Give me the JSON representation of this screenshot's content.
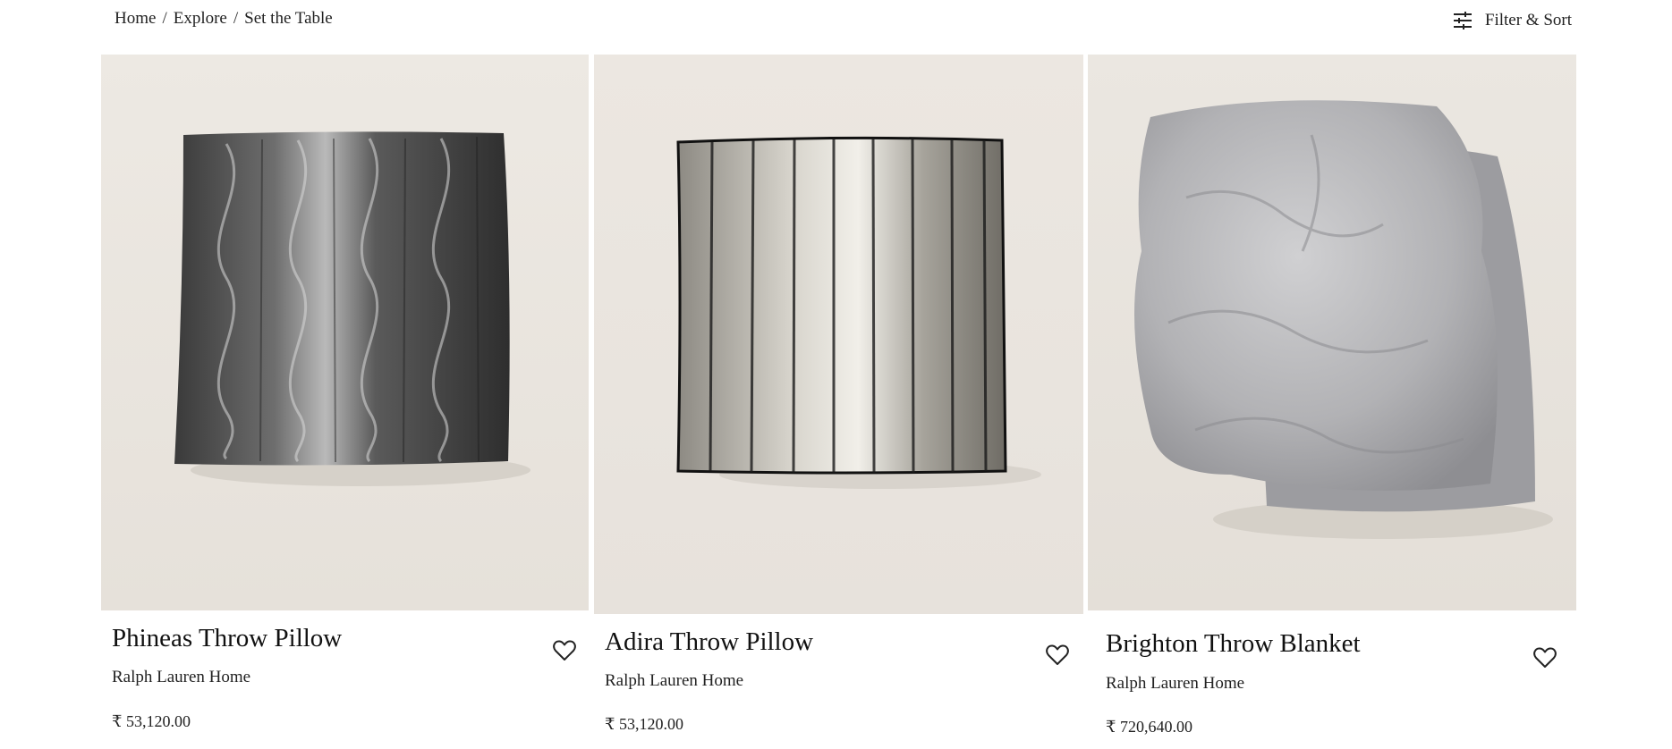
{
  "breadcrumb": {
    "items": [
      "Home",
      "Explore",
      "Set the Table"
    ],
    "separator": "/"
  },
  "toolbar": {
    "filter_sort_label": "Filter & Sort",
    "filter_icon": "sliders-icon"
  },
  "products": [
    {
      "name": "Phineas Throw Pillow",
      "brand": "Ralph Lauren Home",
      "price": "₹ 53,120.00",
      "image": "dark-sequined-pillow"
    },
    {
      "name": "Adira Throw Pillow",
      "brand": "Ralph Lauren Home",
      "price": "₹ 53,120.00",
      "image": "silver-beaded-pillow"
    },
    {
      "name": "Brighton Throw Blanket",
      "brand": "Ralph Lauren Home",
      "price": "₹ 720,640.00",
      "image": "grey-fur-blanket"
    }
  ],
  "colors": {
    "image_bg": "#e9e4de",
    "text": "#222222"
  }
}
